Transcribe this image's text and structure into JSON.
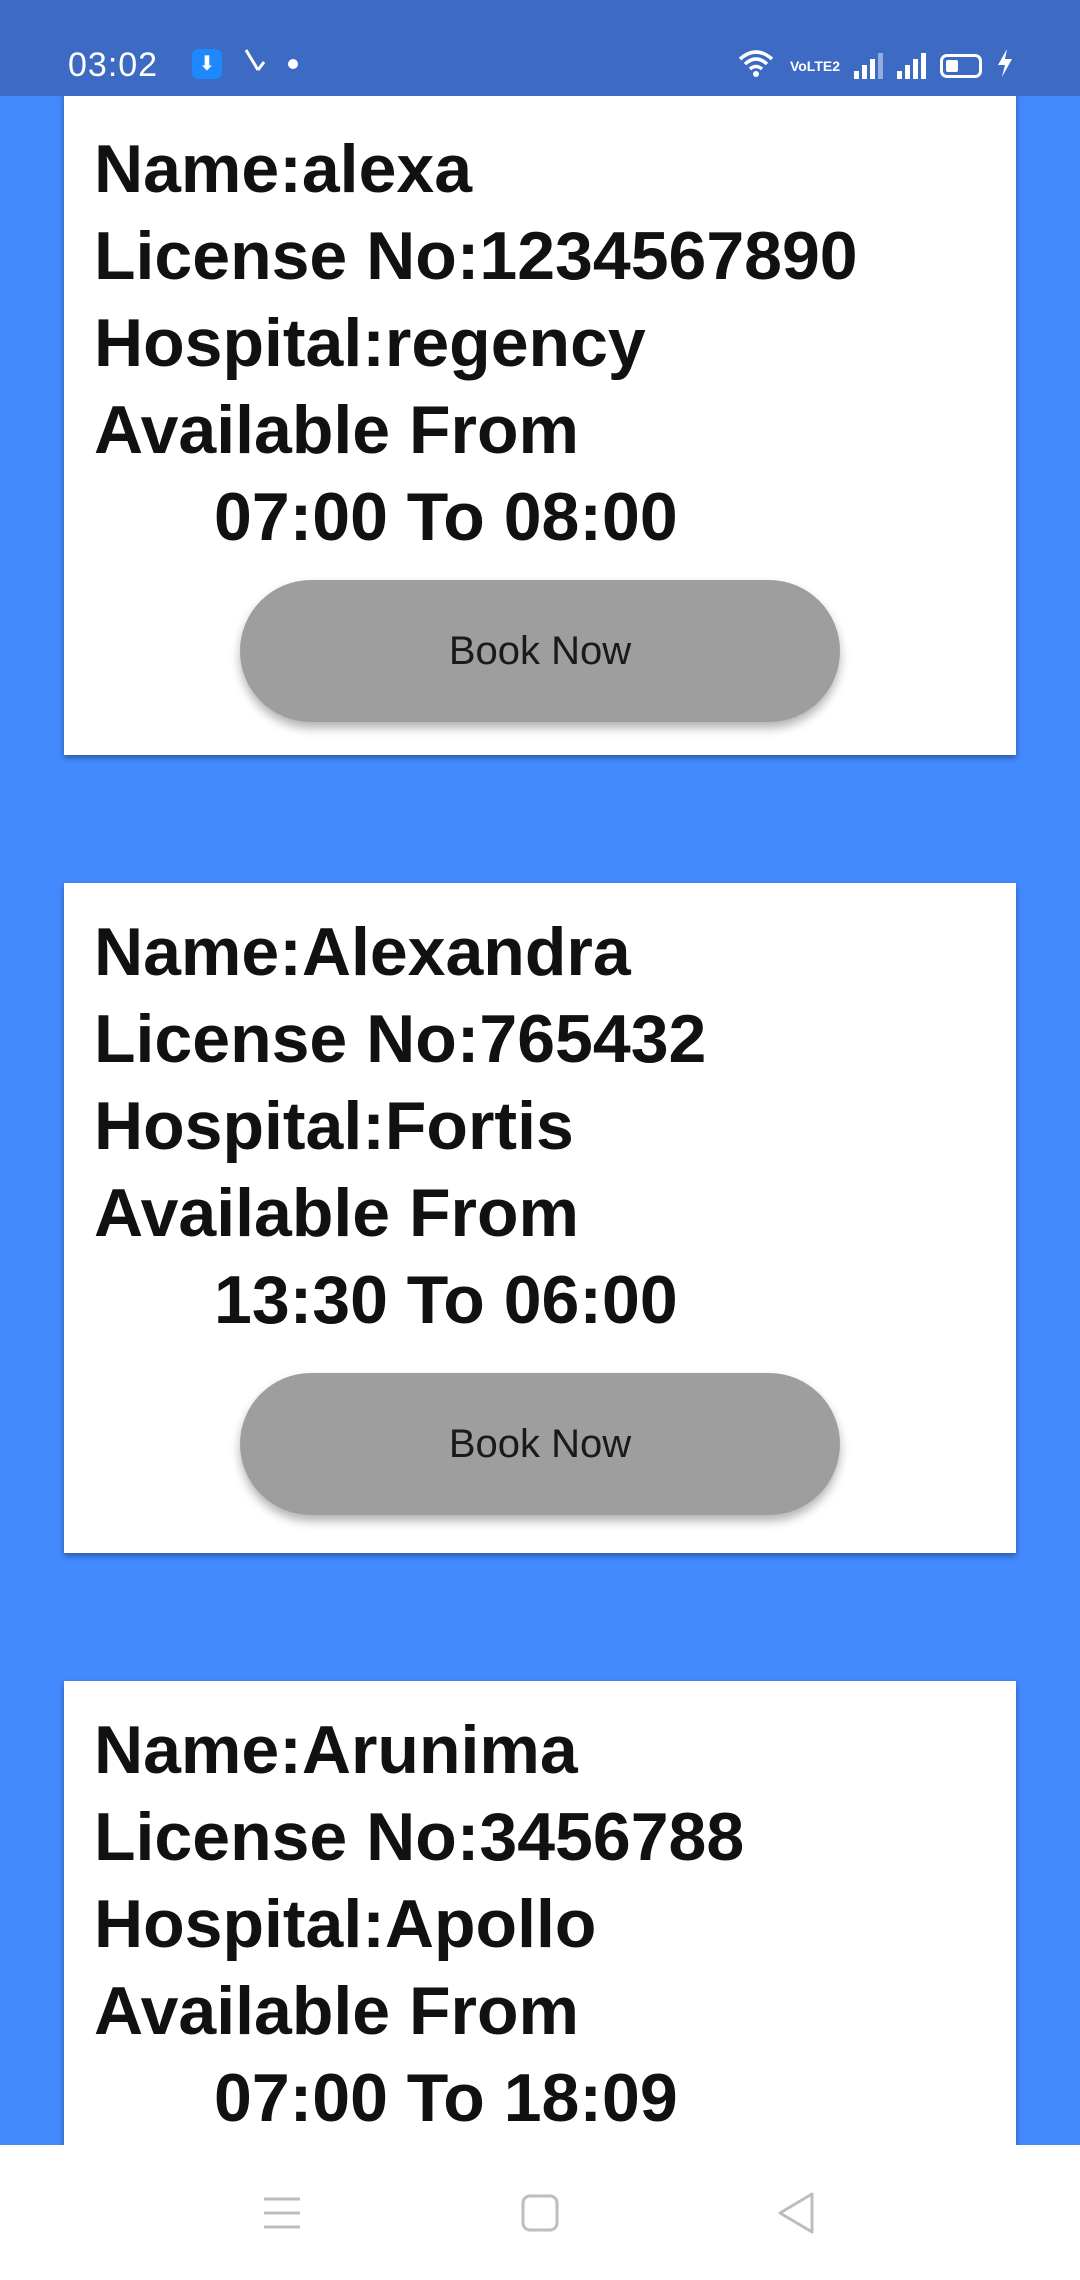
{
  "status_bar": {
    "time": "03:02",
    "left_icons": [
      "usb-debug-icon",
      "missed-call-icon",
      "notification-dot-icon"
    ],
    "right_icons": [
      "wifi-icon",
      "volte-icon",
      "signal-1-icon",
      "signal-2-icon",
      "battery-charging-icon"
    ],
    "volte_text": "VoLTE2"
  },
  "doctors": [
    {
      "name_line": "Name:alexa",
      "license_line": "License No:1234567890",
      "hospital_line": "Hospital:regency",
      "available_label": "Available From",
      "time_range": "07:00 To 08:00",
      "button_label": "Book Now"
    },
    {
      "name_line": "Name:Alexandra",
      "license_line": "License No:765432",
      "hospital_line": "Hospital:Fortis",
      "available_label": "Available From",
      "time_range": "13:30 To 06:00",
      "button_label": "Book Now"
    },
    {
      "name_line": "Name:Arunima",
      "license_line": "License No:3456788",
      "hospital_line": "Hospital:Apollo",
      "available_label": "Available From",
      "time_range": "07:00 To 18:09"
    }
  ],
  "nav_bar": {
    "buttons": [
      "menu-icon",
      "home-icon",
      "back-icon"
    ]
  },
  "colors": {
    "background": "#448AFF",
    "status_bar": "#3D6AC3",
    "button": "#9E9E9E",
    "card": "#FFFFFF"
  }
}
